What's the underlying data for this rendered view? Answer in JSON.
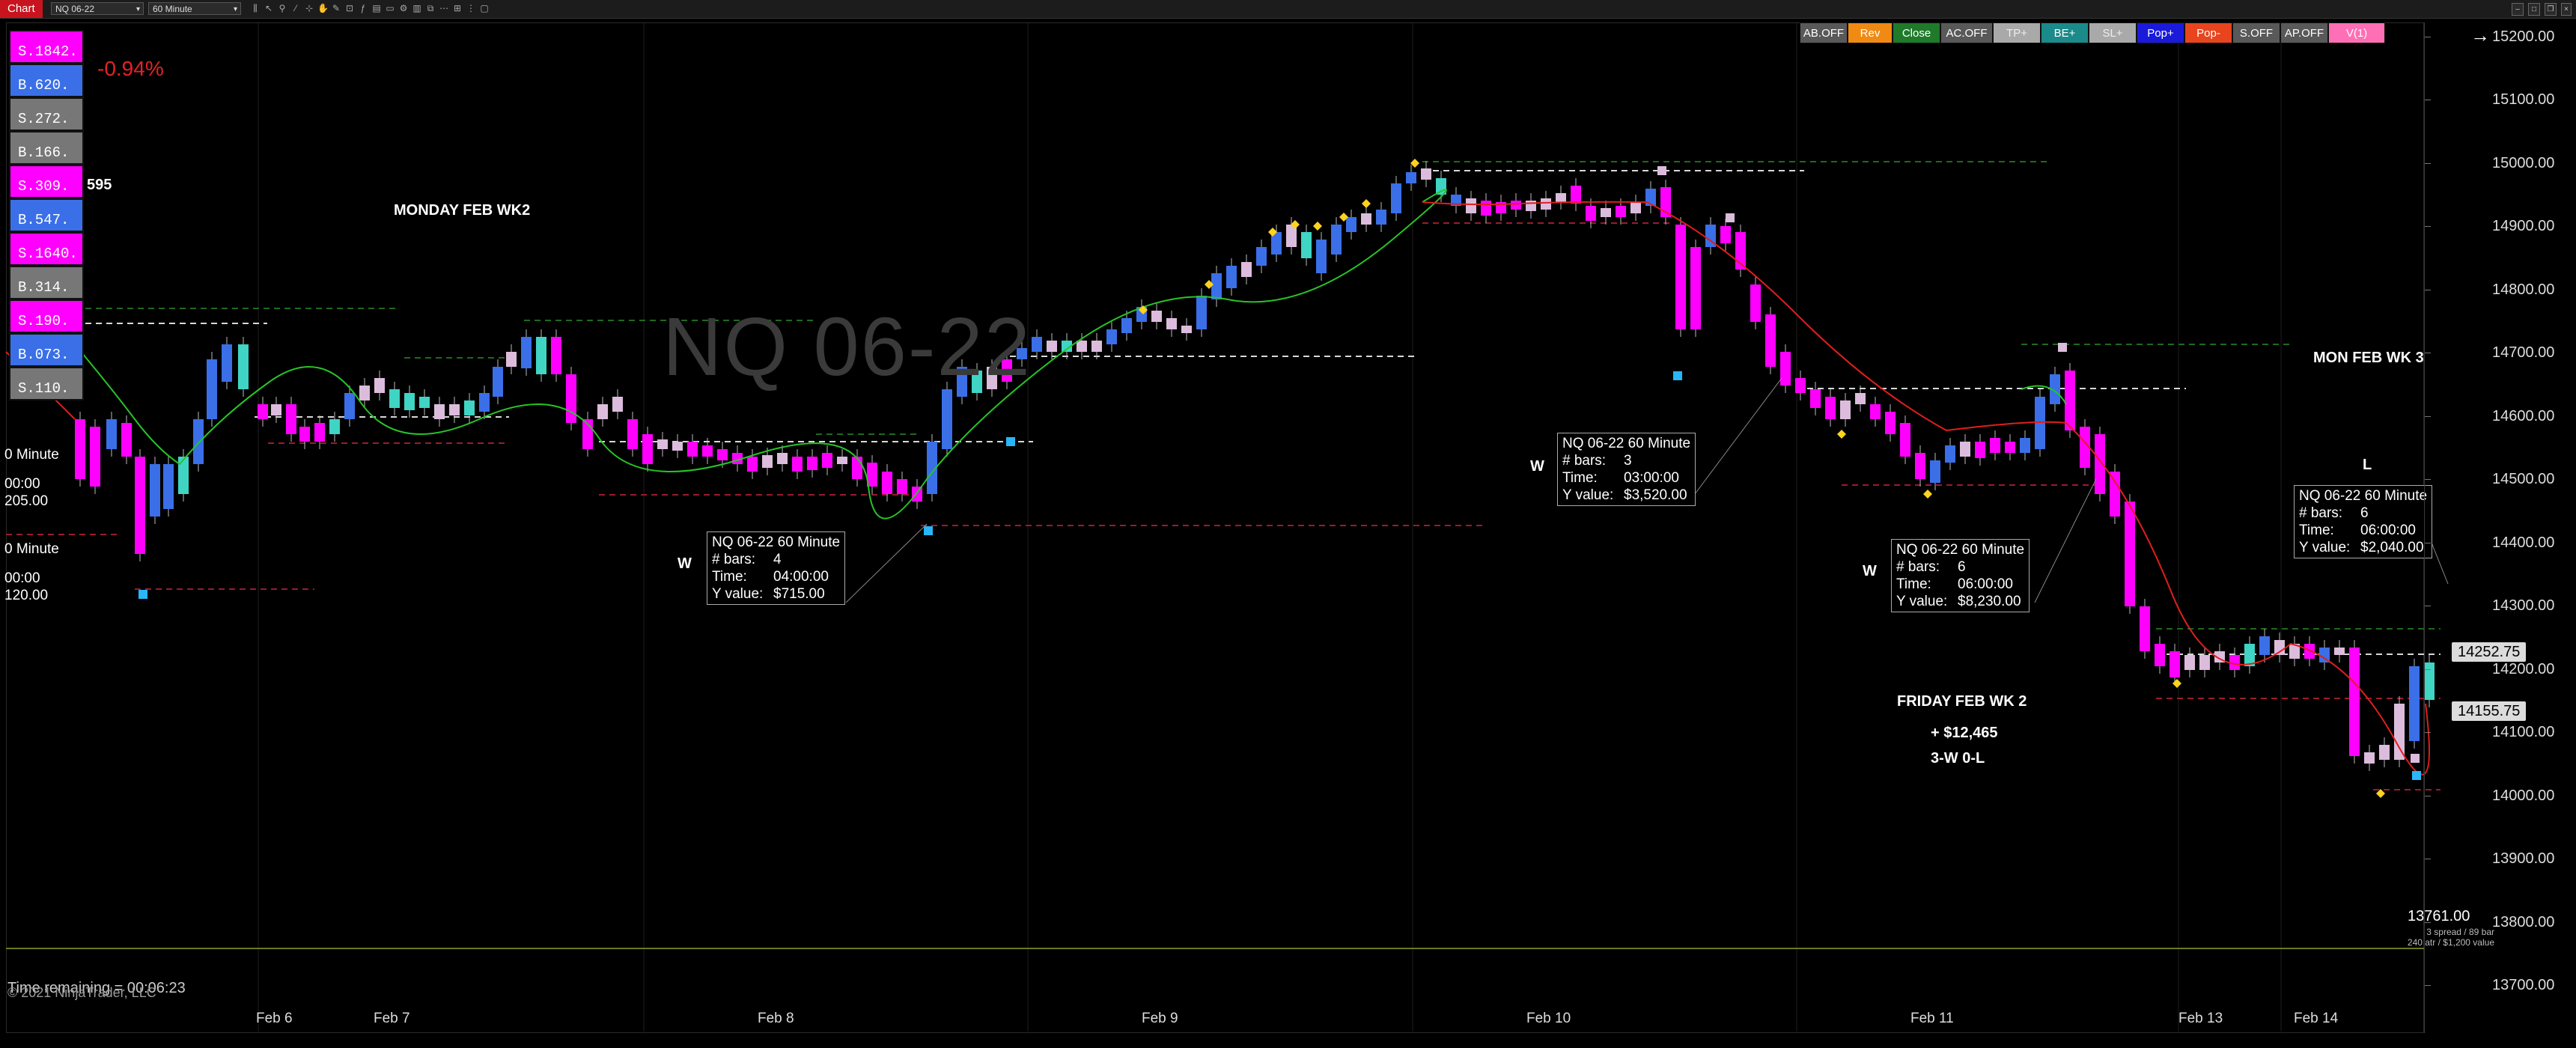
{
  "toolbar": {
    "chart_tab": "Chart",
    "instrument": "NQ 06-22",
    "interval": "60 Minute"
  },
  "strategy_buttons": [
    {
      "label": "AB.OFF",
      "color": "#595959"
    },
    {
      "label": "Rev",
      "color": "#f08a13"
    },
    {
      "label": "Close",
      "color": "#1f7a2a"
    },
    {
      "label": "AC.OFF",
      "color": "#595959"
    },
    {
      "label": "TP+",
      "color": "#a9a9a9"
    },
    {
      "label": "BE+",
      "color": "#1a8a8a"
    },
    {
      "label": "SL+",
      "color": "#a9a9a9"
    },
    {
      "label": "Pop+",
      "color": "#1a1adb"
    },
    {
      "label": "Pop-",
      "color": "#e8441e"
    },
    {
      "label": "S.OFF",
      "color": "#595959"
    },
    {
      "label": "AP.OFF",
      "color": "#595959"
    },
    {
      "label": "V(1)",
      "color": "#ff6fb5"
    }
  ],
  "positions": [
    {
      "label": "S.1842.",
      "color": "#ff00ff"
    },
    {
      "label": "B.620.",
      "color": "#3a6fe8"
    },
    {
      "label": "S.272.",
      "color": "#777777"
    },
    {
      "label": "B.166.",
      "color": "#777777"
    },
    {
      "label": "S.309.",
      "color": "#ff00ff"
    },
    {
      "label": "B.547.",
      "color": "#3a6fe8"
    },
    {
      "label": "S.1640.",
      "color": "#ff00ff"
    },
    {
      "label": "B.314.",
      "color": "#777777"
    },
    {
      "label": "S.190.",
      "color": "#ff00ff"
    },
    {
      "label": "B.073.",
      "color": "#3a6fe8"
    },
    {
      "label": "S.110.",
      "color": "#777777"
    }
  ],
  "pct_change": "-0.94%",
  "partial_number": "595",
  "watermark": "NQ 06-22",
  "price_axis": {
    "ticks": [
      "15200.00",
      "15100.00",
      "15000.00",
      "14900.00",
      "14800.00",
      "14700.00",
      "14600.00",
      "14500.00",
      "14400.00",
      "14300.00",
      "14200.00",
      "14100.00",
      "14000.00",
      "13900.00",
      "13800.00",
      "13700.00"
    ],
    "current_price_1": "14252.75",
    "current_price_2": "14155.75"
  },
  "time_axis": [
    "Feb 6",
    "Feb 7",
    "Feb 8",
    "Feb 9",
    "Feb 10",
    "Feb 11",
    "Feb 13",
    "Feb 14"
  ],
  "annotations": {
    "monday_wk2": "MONDAY FEB WK2",
    "mon_wk3": "MON FEB WK 3",
    "friday_wk2": "FRIDAY FEB WK 2",
    "profit": "+ $12,465",
    "record": "3-W 0-L",
    "w_label": "W",
    "l_label": "L"
  },
  "tooltips": [
    {
      "title": "NQ 06-22 60 Minute",
      "bars_key": "# bars:",
      "bars": "4",
      "time_key": "Time:",
      "time": "04:00:00",
      "y_key": "Y value:",
      "y": "$715.00"
    },
    {
      "title": "NQ 06-22 60 Minute",
      "bars_key": "# bars:",
      "bars": "3",
      "time_key": "Time:",
      "time": "03:00:00",
      "y_key": "Y value:",
      "y": "$3,520.00"
    },
    {
      "title": "NQ 06-22 60 Minute",
      "bars_key": "# bars:",
      "bars": "6",
      "time_key": "Time:",
      "time": "06:00:00",
      "y_key": "Y value:",
      "y": "$8,230.00"
    },
    {
      "title": "NQ 06-22 60 Minute",
      "bars_key": "# bars:",
      "bars": "6",
      "time_key": "Time:",
      "time": "06:00:00",
      "y_key": "Y value:",
      "y": "$2,040.00"
    }
  ],
  "edge_tooltips": [
    {
      "l1": "0 Minute",
      "l2": "00:00",
      "l3": "205.00"
    },
    {
      "l1": "0 Minute",
      "l2": "00:00",
      "l3": "120.00"
    }
  ],
  "footer": {
    "time_remaining": "Time remaining = 00:06:23",
    "copyright": "© 2021 NinjaTrader, LLC",
    "last_price": "13761.00",
    "spread_info": "3 spread / 89 bar",
    "atr_info": "240 atr / $1,200 value"
  },
  "colors": {
    "bull_candle": "#3a6fe8",
    "bull_strong": "#3fd4c4",
    "bear_candle": "#ff00ff",
    "neutral_candle": "#dcbcdc",
    "ema_up": "#27c427",
    "ema_down": "#e01e1e",
    "diamond": "#ffd21f",
    "stop_marker": "#29b6f6"
  }
}
